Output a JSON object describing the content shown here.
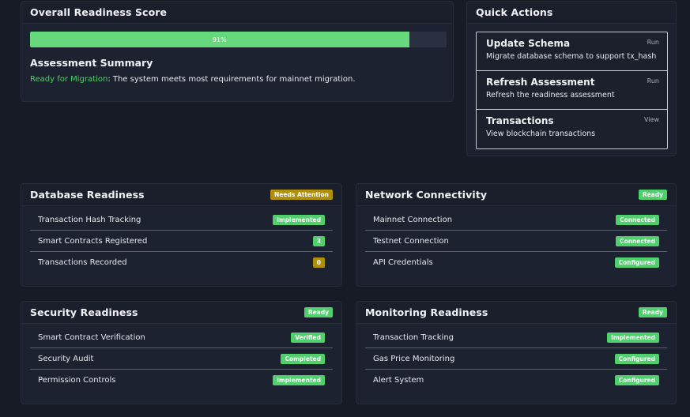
{
  "overall": {
    "title": "Overall Readiness Score",
    "progress_label": "91%",
    "progress_fraction": 0.91,
    "summary_title": "Assessment Summary",
    "status": "Ready for Migration",
    "description": ": The system meets most requirements for mainnet migration."
  },
  "quick_actions": {
    "title": "Quick Actions",
    "items": [
      {
        "title": "Update Schema",
        "description": "Migrate database schema to support tx_hash",
        "action": "Run"
      },
      {
        "title": "Refresh Assessment",
        "description": "Refresh the readiness assessment",
        "action": "Run"
      },
      {
        "title": "Transactions",
        "description": "View blockchain transactions",
        "action": "View"
      }
    ]
  },
  "database": {
    "title": "Database Readiness",
    "badge": "Needs Attention",
    "badge_color": "#b08f0a",
    "rows": [
      {
        "label": "Transaction Hash Tracking",
        "badge": "Implemented",
        "color": "#4fd06c"
      },
      {
        "label": "Smart Contracts Registered",
        "badge": "3",
        "color": "#4fd06c"
      },
      {
        "label": "Transactions Recorded",
        "badge": "0",
        "color": "#b08f0a"
      }
    ]
  },
  "network": {
    "title": "Network Connectivity",
    "badge": "Ready",
    "badge_color": "#4fd06c",
    "rows": [
      {
        "label": "Mainnet Connection",
        "badge": "Connected",
        "color": "#4fd06c"
      },
      {
        "label": "Testnet Connection",
        "badge": "Connected",
        "color": "#4fd06c"
      },
      {
        "label": "API Credentials",
        "badge": "Configured",
        "color": "#4fd06c"
      }
    ]
  },
  "security": {
    "title": "Security Readiness",
    "badge": "Ready",
    "badge_color": "#4fd06c",
    "rows": [
      {
        "label": "Smart Contract Verification",
        "badge": "Verified",
        "color": "#4fd06c"
      },
      {
        "label": "Security Audit",
        "badge": "Completed",
        "color": "#4fd06c"
      },
      {
        "label": "Permission Controls",
        "badge": "Implemented",
        "color": "#4fd06c"
      }
    ]
  },
  "monitoring": {
    "title": "Monitoring Readiness",
    "badge": "Ready",
    "badge_color": "#4fd06c",
    "rows": [
      {
        "label": "Transaction Tracking",
        "badge": "Implemented",
        "color": "#4fd06c"
      },
      {
        "label": "Gas Price Monitoring",
        "badge": "Configured",
        "color": "#4fd06c"
      },
      {
        "label": "Alert System",
        "badge": "Configured",
        "color": "#4fd06c"
      }
    ]
  }
}
